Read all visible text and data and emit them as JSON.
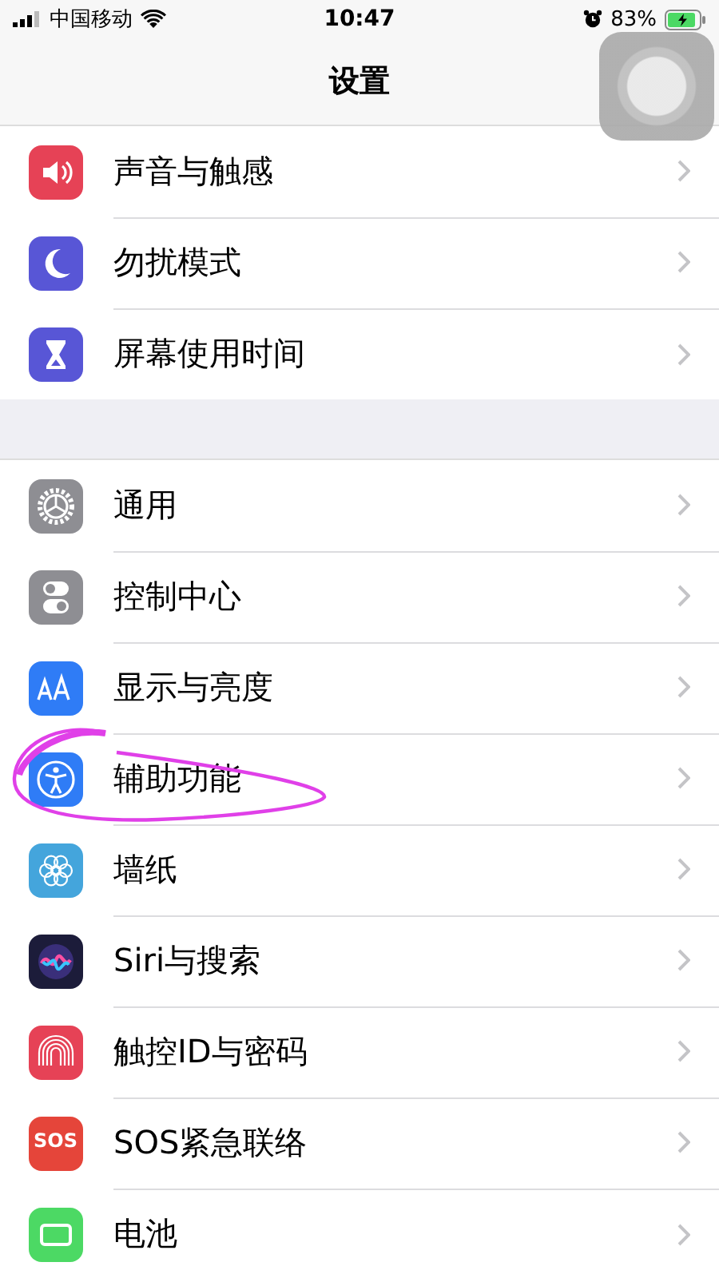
{
  "status_bar": {
    "carrier": "中国移动",
    "time": "10:47",
    "battery": "83%",
    "charging": true
  },
  "nav_bar": {
    "title": "设置"
  },
  "groups": [
    {
      "items": [
        {
          "label": "声音与触感",
          "color": "#e64256"
        },
        {
          "label": "勿扰模式",
          "color": "#5856d6"
        },
        {
          "label": "屏幕使用时间",
          "color": "#5856d6"
        }
      ]
    },
    {
      "items": [
        {
          "label": "通用",
          "color": "#8e8e93"
        },
        {
          "label": "控制中心",
          "color": "#8e8e93"
        },
        {
          "label": "显示与亮度",
          "color": "#2f7cf6"
        },
        {
          "label": "辅助功能",
          "color": "#2f7cf6",
          "circled": true
        },
        {
          "label": "墙纸",
          "color": "#44a5dc"
        },
        {
          "label": "Siri与搜索",
          "color": "#1c1c3a"
        },
        {
          "label": "触控ID与密码",
          "color": "#e64256"
        },
        {
          "label": "SOS紧急联络",
          "color": "#e5453a",
          "icon_text": "SOS"
        },
        {
          "label": "电池",
          "color": "#4cd964"
        }
      ]
    }
  ]
}
